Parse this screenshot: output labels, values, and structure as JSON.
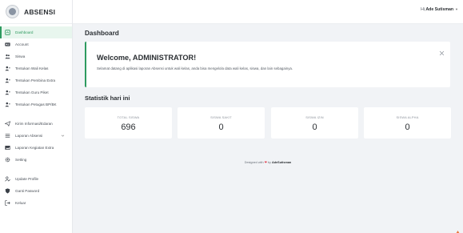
{
  "brand": {
    "name": "ABSENSI"
  },
  "sidebar": {
    "items": [
      {
        "label": "Dashboard",
        "icon": "dashboard-icon",
        "active": true
      },
      {
        "label": "Account",
        "icon": "id-card-icon"
      },
      {
        "label": "Siswa",
        "icon": "users-icon"
      },
      {
        "label": "Tentukan Wali Kelas",
        "icon": "user-assign-icon"
      },
      {
        "label": "Tentukan Pembina Extra",
        "icon": "user-assign-icon"
      },
      {
        "label": "Tentukan Guru Piket",
        "icon": "user-assign-icon"
      },
      {
        "label": "Tentukan Petugas BP/BK",
        "icon": "user-assign-icon"
      },
      {
        "label": "Kirim Informasi/Edaran",
        "icon": "send-icon"
      },
      {
        "label": "Laporan Absensi",
        "icon": "list-icon",
        "has_submenu": true
      },
      {
        "label": "Laporan Kegiatan Extra",
        "icon": "image-icon"
      },
      {
        "label": "Setting",
        "icon": "gear-icon"
      },
      {
        "label": "Update Profile",
        "icon": "user-edit-icon"
      },
      {
        "label": "Ganti Pasword",
        "icon": "shield-icon"
      },
      {
        "label": "Keluar",
        "icon": "logout-icon"
      }
    ]
  },
  "topbar": {
    "greeting_prefix": "Hi,",
    "user_name": "Ade Sutisman"
  },
  "main": {
    "title": "Dashboard",
    "welcome": {
      "title": "Welcome, ADMINISTRATOR!",
      "text": "Selamat datang di aplikasi laporan Absensi untuk wali kelas, anda bisa mengelola data wali kelas, siswa, dan lain sebagainya."
    },
    "stats_title": "Statistik hari ini",
    "stats": [
      {
        "label": "TOTAL SISWA",
        "value": "696"
      },
      {
        "label": "SISWA SAKIT",
        "value": "0"
      },
      {
        "label": "SISWA IZIN",
        "value": "0"
      },
      {
        "label": "SISWA ALPHA",
        "value": "0"
      }
    ]
  },
  "footer": {
    "prefix": "Designed with",
    "by": "by",
    "author": "AdeSutisman"
  },
  "colors": {
    "accent": "#2e9a5f",
    "heart": "#e0404f",
    "scroll_top": "#e8763a"
  }
}
